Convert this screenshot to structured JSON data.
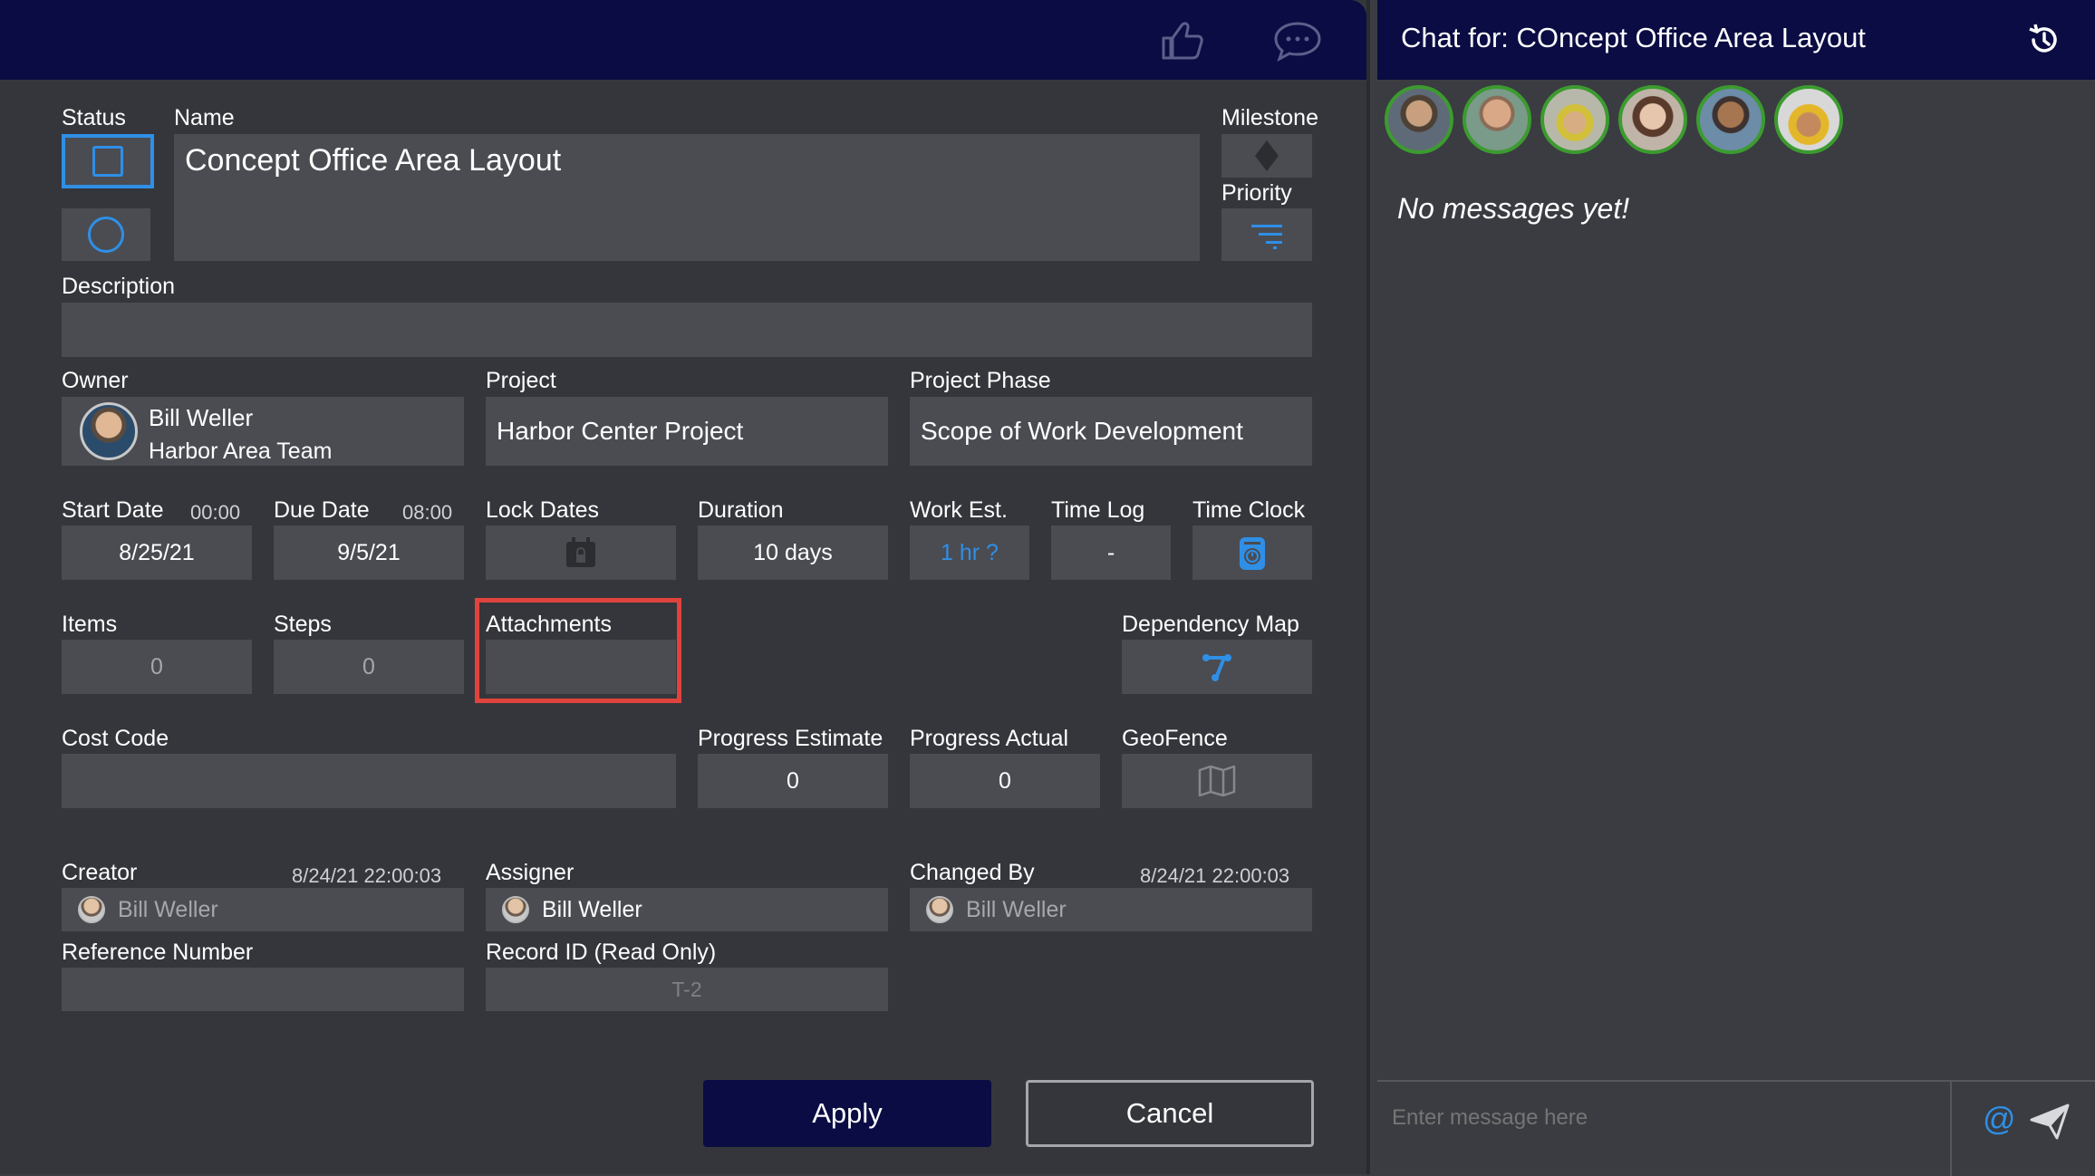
{
  "form": {
    "labels": {
      "status": "Status",
      "name": "Name",
      "milestone": "Milestone",
      "priority": "Priority",
      "description": "Description",
      "owner": "Owner",
      "project": "Project",
      "project_phase": "Project Phase",
      "start_date": "Start Date",
      "due_date": "Due Date",
      "lock_dates": "Lock Dates",
      "duration": "Duration",
      "work_est": "Work Est.",
      "time_log": "Time Log",
      "time_clock": "Time Clock",
      "items": "Items",
      "steps": "Steps",
      "attachments": "Attachments",
      "dependency_map": "Dependency Map",
      "cost_code": "Cost Code",
      "progress_estimate": "Progress Estimate",
      "progress_actual": "Progress Actual",
      "geofence": "GeoFence",
      "creator": "Creator",
      "assigner": "Assigner",
      "changed_by": "Changed By",
      "reference_number": "Reference Number",
      "record_id": "Record ID (Read Only)"
    },
    "values": {
      "name": "Concept Office Area Layout",
      "description": "",
      "owner_name": "Bill Weller",
      "owner_team": "Harbor Area Team",
      "project": "Harbor Center Project",
      "project_phase": "Scope of Work Development",
      "start_time": "00:00",
      "start_date": "8/25/21",
      "due_time": "08:00",
      "due_date": "9/5/21",
      "duration": "10 days",
      "work_est": "1 hr ?",
      "time_log": "-",
      "items": "0",
      "steps": "0",
      "cost_code": "",
      "progress_estimate": "0",
      "progress_actual": "0",
      "creator_stamp": "8/24/21  22:00:03",
      "creator": "Bill Weller",
      "assigner": "Bill Weller",
      "changed_stamp": "8/24/21  22:00:03",
      "changed_by": "Bill Weller",
      "reference_number": "",
      "record_id": "T-2"
    },
    "buttons": {
      "apply": "Apply",
      "cancel": "Cancel"
    },
    "colors": {
      "accent_blue": "#2f8fe6",
      "header_navy": "#0a0c43",
      "highlight_red": "#e0433c",
      "member_ring_green": "#3c9b2f"
    }
  },
  "header_icons": [
    "thumbs-up-icon",
    "chat-bubble-icon"
  ],
  "chat": {
    "title": "Chat for: COncept Office Area Layout",
    "empty_message": "No messages yet!",
    "input_placeholder": "Enter message here",
    "mention_symbol": "@",
    "members": [
      "member-1",
      "member-2",
      "member-3",
      "member-4",
      "member-5",
      "member-6"
    ]
  }
}
